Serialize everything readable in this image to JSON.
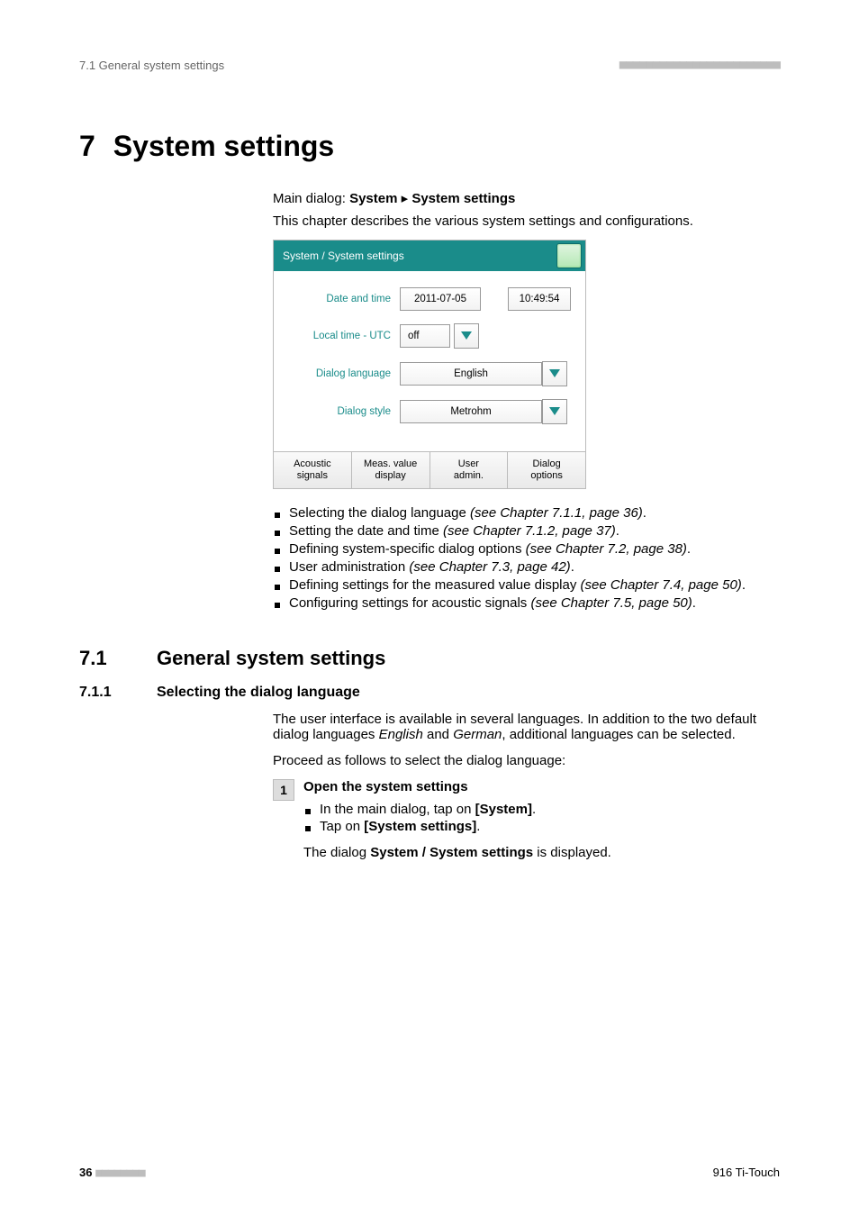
{
  "header": {
    "left": "7.1 General system settings",
    "right_dashes": "■■■■■■■■■■■■■■■■■■■■■■■■"
  },
  "chapter": {
    "num": "7",
    "title": "System settings"
  },
  "main_dialog": {
    "prefix": "Main dialog:",
    "b1": "System",
    "tri": "▸",
    "b2": "System settings"
  },
  "intro": "This chapter describes the various system settings and configurations.",
  "shot": {
    "title": "System / System settings",
    "rows": {
      "date_label": "Date and time",
      "date_val": "2011-07-05",
      "time_val": "10:49:54",
      "utc_label": "Local time - UTC",
      "utc_val": "off",
      "lang_label": "Dialog language",
      "lang_val": "English",
      "style_label": "Dialog style",
      "style_val": "Metrohm"
    },
    "buttons": {
      "b1a": "Acoustic",
      "b1b": "signals",
      "b2a": "Meas. value",
      "b2b": "display",
      "b3a": "User",
      "b3b": "admin.",
      "b4a": "Dialog",
      "b4b": "options"
    }
  },
  "bullets": [
    {
      "text": "Selecting the dialog language ",
      "ref": "(see Chapter 7.1.1, page 36)"
    },
    {
      "text": "Setting the date and time ",
      "ref": "(see Chapter 7.1.2, page 37)"
    },
    {
      "text": "Defining system-specific dialog options ",
      "ref": "(see Chapter 7.2, page 38)"
    },
    {
      "text": "User administration ",
      "ref": "(see Chapter 7.3, page 42)"
    },
    {
      "text": "Defining settings for the measured value display ",
      "ref": "(see Chapter 7.4, page 50)"
    },
    {
      "text": "Configuring settings for acoustic signals ",
      "ref": "(see Chapter 7.5, page 50)"
    }
  ],
  "section": {
    "num": "7.1",
    "title": "General system settings"
  },
  "subsection": {
    "num": "7.1.1",
    "title": "Selecting the dialog language"
  },
  "para1_a": "The user interface is available in several languages. In addition to the two default dialog languages ",
  "para1_i1": "English",
  "para1_mid": " and ",
  "para1_i2": "German",
  "para1_b": ", additional languages can be selected.",
  "para2": "Proceed as follows to select the dialog language:",
  "step": {
    "num": "1",
    "title": "Open the system settings",
    "b1_a": "In the main dialog, tap on ",
    "b1_b": "[System]",
    "b1_c": ".",
    "b2_a": "Tap on ",
    "b2_b": "[System settings]",
    "b2_c": ".",
    "result_a": "The dialog ",
    "result_b": "System / System settings",
    "result_c": " is displayed."
  },
  "footer": {
    "page": "36",
    "dashes": "■■■■■■■■",
    "product": "916 Ti-Touch"
  }
}
